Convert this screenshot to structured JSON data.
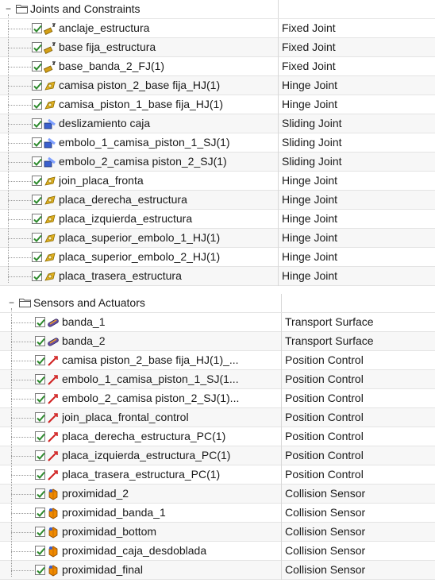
{
  "joints": {
    "group_label": "Joints and Constraints",
    "items": [
      {
        "name": "anclaje_estructura",
        "type": "Fixed Joint",
        "icon": "fixed-joint-icon"
      },
      {
        "name": "base fija_estructura",
        "type": "Fixed Joint",
        "icon": "fixed-joint-icon"
      },
      {
        "name": "base_banda_2_FJ(1)",
        "type": "Fixed Joint",
        "icon": "fixed-joint-icon"
      },
      {
        "name": "camisa piston_2_base fija_HJ(1)",
        "type": "Hinge Joint",
        "icon": "hinge-joint-icon"
      },
      {
        "name": "camisa_piston_1_base fija_HJ(1)",
        "type": "Hinge Joint",
        "icon": "hinge-joint-icon"
      },
      {
        "name": "deslizamiento caja",
        "type": "Sliding Joint",
        "icon": "sliding-joint-icon"
      },
      {
        "name": "embolo_1_camisa_piston_1_SJ(1)",
        "type": "Sliding Joint",
        "icon": "sliding-joint-icon"
      },
      {
        "name": "embolo_2_camisa piston_2_SJ(1)",
        "type": "Sliding Joint",
        "icon": "sliding-joint-icon"
      },
      {
        "name": "join_placa_fronta",
        "type": "Hinge Joint",
        "icon": "hinge-joint-icon"
      },
      {
        "name": "placa_derecha_estructura",
        "type": "Hinge Joint",
        "icon": "hinge-joint-icon"
      },
      {
        "name": "placa_izquierda_estructura",
        "type": "Hinge Joint",
        "icon": "hinge-joint-icon"
      },
      {
        "name": "placa_superior_embolo_1_HJ(1)",
        "type": "Hinge Joint",
        "icon": "hinge-joint-icon"
      },
      {
        "name": "placa_superior_embolo_2_HJ(1)",
        "type": "Hinge Joint",
        "icon": "hinge-joint-icon"
      },
      {
        "name": "placa_trasera_estructura",
        "type": "Hinge Joint",
        "icon": "hinge-joint-icon"
      }
    ]
  },
  "sensors": {
    "group_label": "Sensors and Actuators",
    "items": [
      {
        "name": "banda_1",
        "type": "Transport Surface",
        "icon": "transport-surface-icon"
      },
      {
        "name": "banda_2",
        "type": "Transport Surface",
        "icon": "transport-surface-icon"
      },
      {
        "name": "camisa piston_2_base fija_HJ(1)_...",
        "type": "Position Control",
        "icon": "position-control-icon"
      },
      {
        "name": "embolo_1_camisa_piston_1_SJ(1...",
        "type": "Position Control",
        "icon": "position-control-icon"
      },
      {
        "name": "embolo_2_camisa piston_2_SJ(1)...",
        "type": "Position Control",
        "icon": "position-control-icon"
      },
      {
        "name": "join_placa_frontal_control",
        "type": "Position Control",
        "icon": "position-control-icon"
      },
      {
        "name": "placa_derecha_estructura_PC(1)",
        "type": "Position Control",
        "icon": "position-control-icon"
      },
      {
        "name": "placa_izquierda_estructura_PC(1)",
        "type": "Position Control",
        "icon": "position-control-icon"
      },
      {
        "name": "placa_trasera_estructura_PC(1)",
        "type": "Position Control",
        "icon": "position-control-icon"
      },
      {
        "name": "proximidad_2",
        "type": "Collision Sensor",
        "icon": "collision-sensor-icon"
      },
      {
        "name": "proximidad_banda_1",
        "type": "Collision Sensor",
        "icon": "collision-sensor-icon"
      },
      {
        "name": "proximidad_bottom",
        "type": "Collision Sensor",
        "icon": "collision-sensor-icon"
      },
      {
        "name": "proximidad_caja_desdoblada",
        "type": "Collision Sensor",
        "icon": "collision-sensor-icon"
      },
      {
        "name": "proximidad_final",
        "type": "Collision Sensor",
        "icon": "collision-sensor-icon"
      }
    ]
  },
  "colors": {
    "check": "#2e8b2e",
    "fixed": "#d4a017",
    "hinge": "#e0b020",
    "sliding": "#3a5fcd",
    "transport": "#6a4ea0",
    "position": "#d02020",
    "collision": "#f08a00"
  }
}
